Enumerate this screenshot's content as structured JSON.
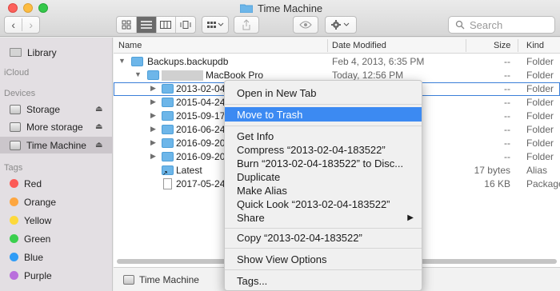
{
  "window": {
    "title": "Time Machine"
  },
  "toolbar": {
    "back_icon": "chevron-left-icon",
    "forward_icon": "chevron-right-icon",
    "search_placeholder": "Search"
  },
  "sidebar": {
    "icloud_head": "iCloud",
    "devices_head": "Devices",
    "tags_head": "Tags",
    "favorites": [
      {
        "label": "Library"
      }
    ],
    "devices": [
      {
        "label": "Storage"
      },
      {
        "label": "More storage"
      },
      {
        "label": "Time Machine"
      }
    ],
    "tags": [
      {
        "label": "Red",
        "color": "#fc5b57"
      },
      {
        "label": "Orange",
        "color": "#fda640"
      },
      {
        "label": "Yellow",
        "color": "#fdd93b"
      },
      {
        "label": "Green",
        "color": "#3bcf4e"
      },
      {
        "label": "Blue",
        "color": "#2f9cf6"
      },
      {
        "label": "Purple",
        "color": "#b96fdc"
      }
    ]
  },
  "columns": {
    "name": "Name",
    "date": "Date Modified",
    "size": "Size",
    "kind": "Kind"
  },
  "rows": [
    {
      "name": "Backups.backupdb",
      "date": "Feb 4, 2013, 6:35 PM",
      "size": "--",
      "kind": "Folder"
    },
    {
      "name": "MacBook Pro",
      "date": "Today, 12:56 PM",
      "size": "--",
      "kind": "Folder"
    },
    {
      "name": "2013-02-04",
      "size": "--",
      "kind": "Folder"
    },
    {
      "name": "2015-04-24",
      "size": "--",
      "kind": "Folder"
    },
    {
      "name": "2015-09-17",
      "size": "--",
      "kind": "Folder"
    },
    {
      "name": "2016-06-24",
      "size": "--",
      "kind": "Folder"
    },
    {
      "name": "2016-09-20",
      "size": "--",
      "kind": "Folder"
    },
    {
      "name": "2016-09-20",
      "size": "--",
      "kind": "Folder"
    },
    {
      "name": "Latest",
      "size": "17 bytes",
      "kind": "Alias"
    },
    {
      "name": "2017-05-24",
      "size": "16 KB",
      "kind": "Package"
    }
  ],
  "pathbar": {
    "label": "Time Machine"
  },
  "menu": {
    "open_new_tab": "Open in New Tab",
    "move_to_trash": "Move to Trash",
    "get_info": "Get Info",
    "compress": "Compress “2013-02-04-183522”",
    "burn": "Burn “2013-02-04-183522” to Disc...",
    "duplicate": "Duplicate",
    "make_alias": "Make Alias",
    "quick_look": "Quick Look “2013-02-04-183522”",
    "share": "Share",
    "copy": "Copy “2013-02-04-183522”",
    "show_view_options": "Show View Options",
    "tags": "Tags..."
  }
}
